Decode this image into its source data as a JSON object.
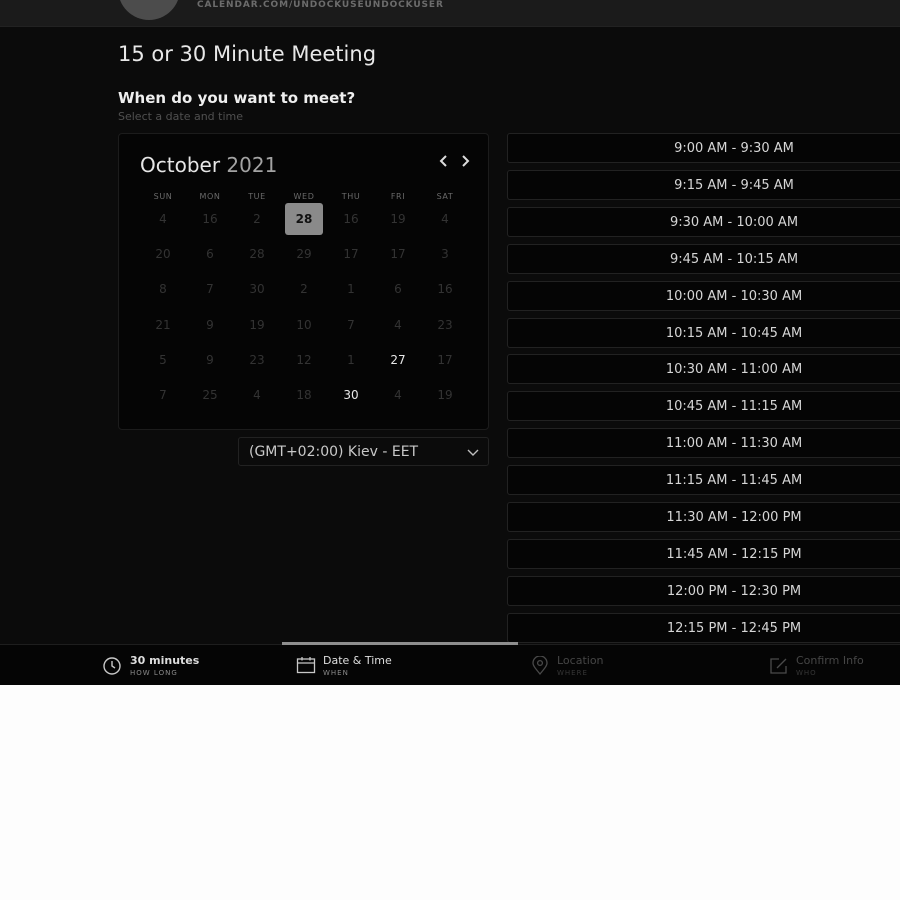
{
  "header": {
    "host_url": "CALENDAR.COM/UNDOCKUSEUNDOCKUSER"
  },
  "event": {
    "title": "15 or 30 Minute Meeting",
    "question": "When do you want to meet?",
    "instruction": "Select a date and time"
  },
  "calendar": {
    "month": "October",
    "year": "2021",
    "prev_icon": "chevron-left-icon",
    "next_icon": "chevron-right-icon",
    "weekdays": [
      "SUN",
      "MON",
      "TUE",
      "WED",
      "THU",
      "FRI",
      "SAT"
    ],
    "weeks": [
      [
        "4",
        "16",
        "2",
        "28",
        "16",
        "19",
        "4"
      ],
      [
        "20",
        "6",
        "28",
        "29",
        "17",
        "17",
        "3"
      ],
      [
        "8",
        "7",
        "30",
        "2",
        "1",
        "6",
        "16"
      ],
      [
        "21",
        "9",
        "19",
        "10",
        "7",
        "4",
        "23"
      ],
      [
        "5",
        "9",
        "23",
        "12",
        "1",
        "27",
        "17"
      ],
      [
        "7",
        "25",
        "4",
        "18",
        "30",
        "4",
        "19"
      ]
    ],
    "available_days": [
      "28",
      "27",
      "30"
    ],
    "selected_day": "28"
  },
  "timezone": {
    "label": "(GMT+02:00) Kiev - EET",
    "icon": "chevron-down-icon"
  },
  "time_slots": [
    "9:00 AM - 9:30 AM",
    "9:15 AM - 9:45 AM",
    "9:30 AM - 10:00 AM",
    "9:45 AM - 10:15 AM",
    "10:00 AM - 10:30 AM",
    "10:15 AM - 10:45 AM",
    "10:30 AM - 11:00 AM",
    "10:45 AM - 11:15 AM",
    "11:00 AM - 11:30 AM",
    "11:15 AM - 11:45 AM",
    "11:30 AM - 12:00 PM",
    "11:45 AM - 12:15 PM",
    "12:00 PM - 12:30 PM",
    "12:15 PM - 12:45 PM"
  ],
  "steps": [
    {
      "title": "30 minutes",
      "subtitle": "HOW LONG",
      "icon": "clock-icon",
      "state": "done"
    },
    {
      "title": "Date & Time",
      "subtitle": "WHEN",
      "icon": "calendar-icon",
      "state": "active"
    },
    {
      "title": "Location",
      "subtitle": "WHERE",
      "icon": "location-pin-icon",
      "state": "pending"
    },
    {
      "title": "Confirm Info",
      "subtitle": "WHO",
      "icon": "edit-icon",
      "state": "pending"
    }
  ],
  "colors": {
    "background": "#0b0b0b",
    "selected_day": "#8a8a8a",
    "text": "#e8e8e8"
  }
}
